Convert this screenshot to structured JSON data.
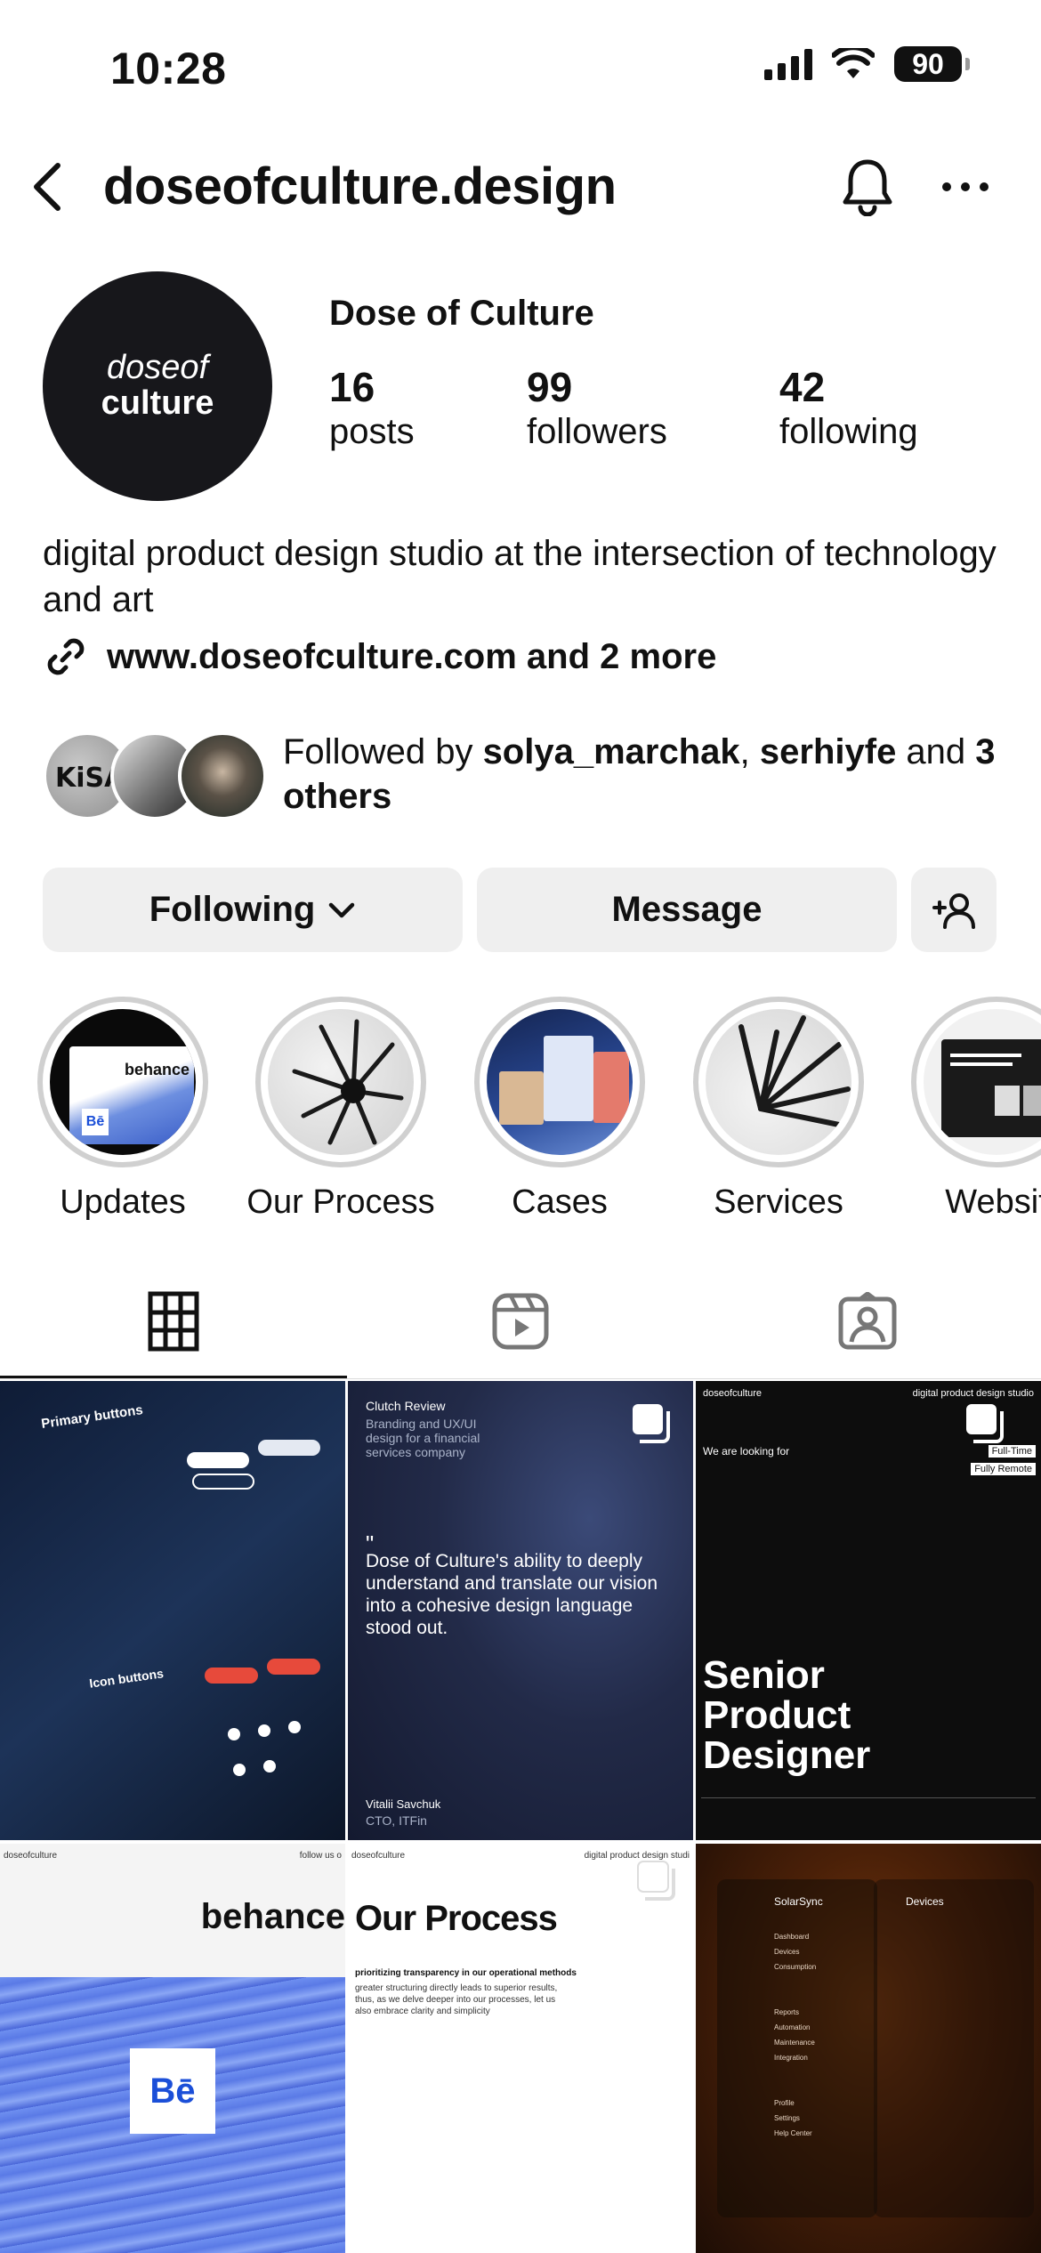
{
  "status_bar": {
    "time": "10:28",
    "battery": "90"
  },
  "nav": {
    "title": "doseofculture.design"
  },
  "profile": {
    "avatar_line1": "doseof",
    "avatar_line2": "culture",
    "display_name": "Dose of Culture",
    "stats": [
      {
        "number": "16",
        "label": "posts"
      },
      {
        "number": "99",
        "label": "followers"
      },
      {
        "number": "42",
        "label": "following"
      }
    ],
    "bio": "digital product design studio at the intersection of technology and art",
    "link": "www.doseofculture.com and 2 more",
    "followed_by": {
      "prefix": "Followed by ",
      "user1": "solya_marchak",
      "sep": ", ",
      "user2": "serhiyfe",
      "mid": " and ",
      "others": "3 others"
    }
  },
  "buttons": {
    "following": "Following",
    "message": "Message"
  },
  "highlights": [
    {
      "label": "Updates"
    },
    {
      "label": "Our Process"
    },
    {
      "label": "Cases"
    },
    {
      "label": "Services"
    },
    {
      "label": "Websit"
    }
  ],
  "posts": {
    "p1": {
      "heading": "Primary buttons",
      "heading2": "Icon buttons"
    },
    "p2": {
      "kicker": "Clutch Review",
      "sub": "Branding and UX/UI design for a financial services company",
      "quote": "Dose of Culture's ability to deeply understand and translate our vision into a cohesive design language stood out.",
      "author": "Vitalii Savchuk",
      "role": "CTO, ITFin"
    },
    "p3": {
      "brand": "doseofculture",
      "tagline": "digital product design studio",
      "looking": "We are looking for",
      "tag1": "Full-Time",
      "tag2": "Fully Remote",
      "title": "Senior Product Designer"
    },
    "p4": {
      "brand": "doseofculture",
      "follow": "follow us o",
      "title": "behance",
      "logo": "Bē"
    },
    "p5": {
      "brand": "doseofculture",
      "tagline": "digital product design studi",
      "title": "Our Process",
      "sub": "prioritizing transparency in our operational methods",
      "body": "greater structuring directly leads to superior results, thus, as we delve deeper into our processes, let us also embrace clarity and simplicity"
    },
    "p6": {
      "app": "SolarSync",
      "panel": "Devices",
      "items": [
        "Dashboard",
        "Devices",
        "Consumption",
        "Reports",
        "Automation",
        "Maintenance",
        "Integration",
        "Profile",
        "Settings",
        "Help Center"
      ]
    }
  }
}
